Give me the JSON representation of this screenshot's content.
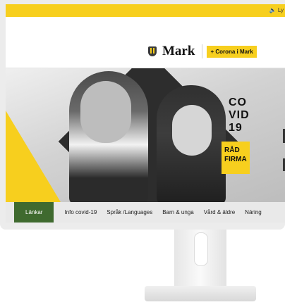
{
  "topbar": {
    "listen_label": "🔈 Ly",
    "color": "#f7cf1e"
  },
  "header": {
    "brand_name": "Mark",
    "corona_button": "+ Corona i Mark"
  },
  "hero": {
    "headline_lines": [
      "CO",
      "VID",
      "19"
    ],
    "advice_lines": [
      "RÅD",
      "FIRMA"
    ]
  },
  "nav": {
    "items": [
      {
        "label": "Länkar",
        "active": true
      },
      {
        "label": "Info covid-19"
      },
      {
        "label": "Språk /Languages"
      },
      {
        "label": "Barn & unga"
      },
      {
        "label": "Vård & äldre"
      },
      {
        "label": "Näring"
      }
    ],
    "active_color": "#3f6a2f"
  }
}
